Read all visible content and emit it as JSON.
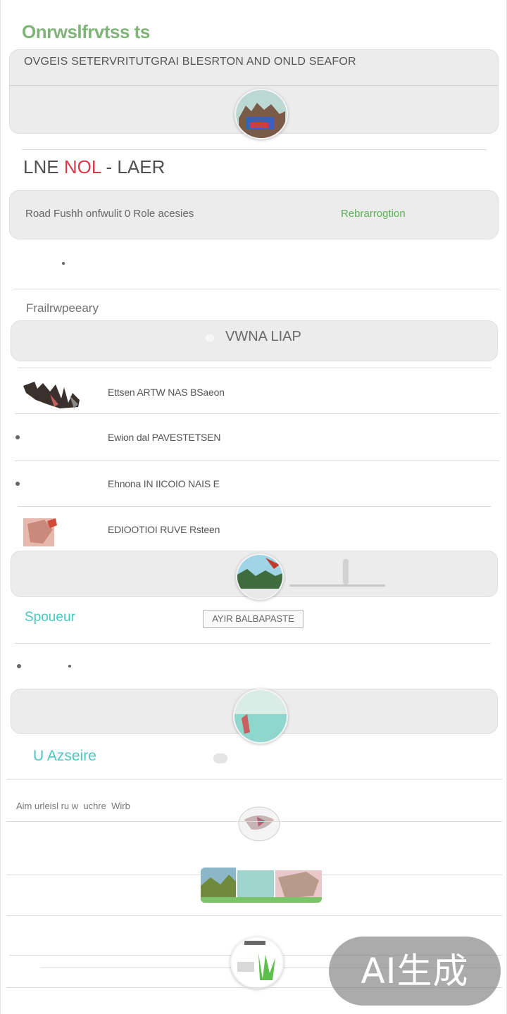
{
  "header": {
    "app_title": "Onrwslfrvtss ts",
    "banner_text": "OVGEIS SETERVRITUTGRAI BLESRTON AND ONLD SEAFOR"
  },
  "section_live": {
    "title_part1": "LNE",
    "title_accent": "NOL",
    "title_part2": "- LAER",
    "row_label": "Road Fushh onfwulit 0 Role acesies",
    "row_link": "Rebrarrogtion"
  },
  "section_primary": {
    "label": "Frailrwpeeary",
    "search_text": "VWNA LIAP",
    "items": [
      {
        "text": "Ettsen ARTW NAS BSaeon"
      },
      {
        "text": "Ewion dal PAVESTETSEN"
      },
      {
        "text": "Ehnona IN IICOIO NAIS E"
      },
      {
        "text": "EDIOOTIOI RUVE Rsteen"
      }
    ]
  },
  "section_spouer": {
    "label": "Spoueur",
    "stamp_button": "AYIR BALBAPASTE"
  },
  "section_azseire": {
    "label": "U Azseire",
    "caption": "Aim urleisl ru w  uchre  Wirb"
  },
  "badge": {
    "text": "AI生成"
  },
  "colors": {
    "accent_green": "#5fae5a",
    "accent_teal": "#4cc6c0",
    "accent_red": "#d63b4a",
    "panel_gray": "#ececec"
  }
}
